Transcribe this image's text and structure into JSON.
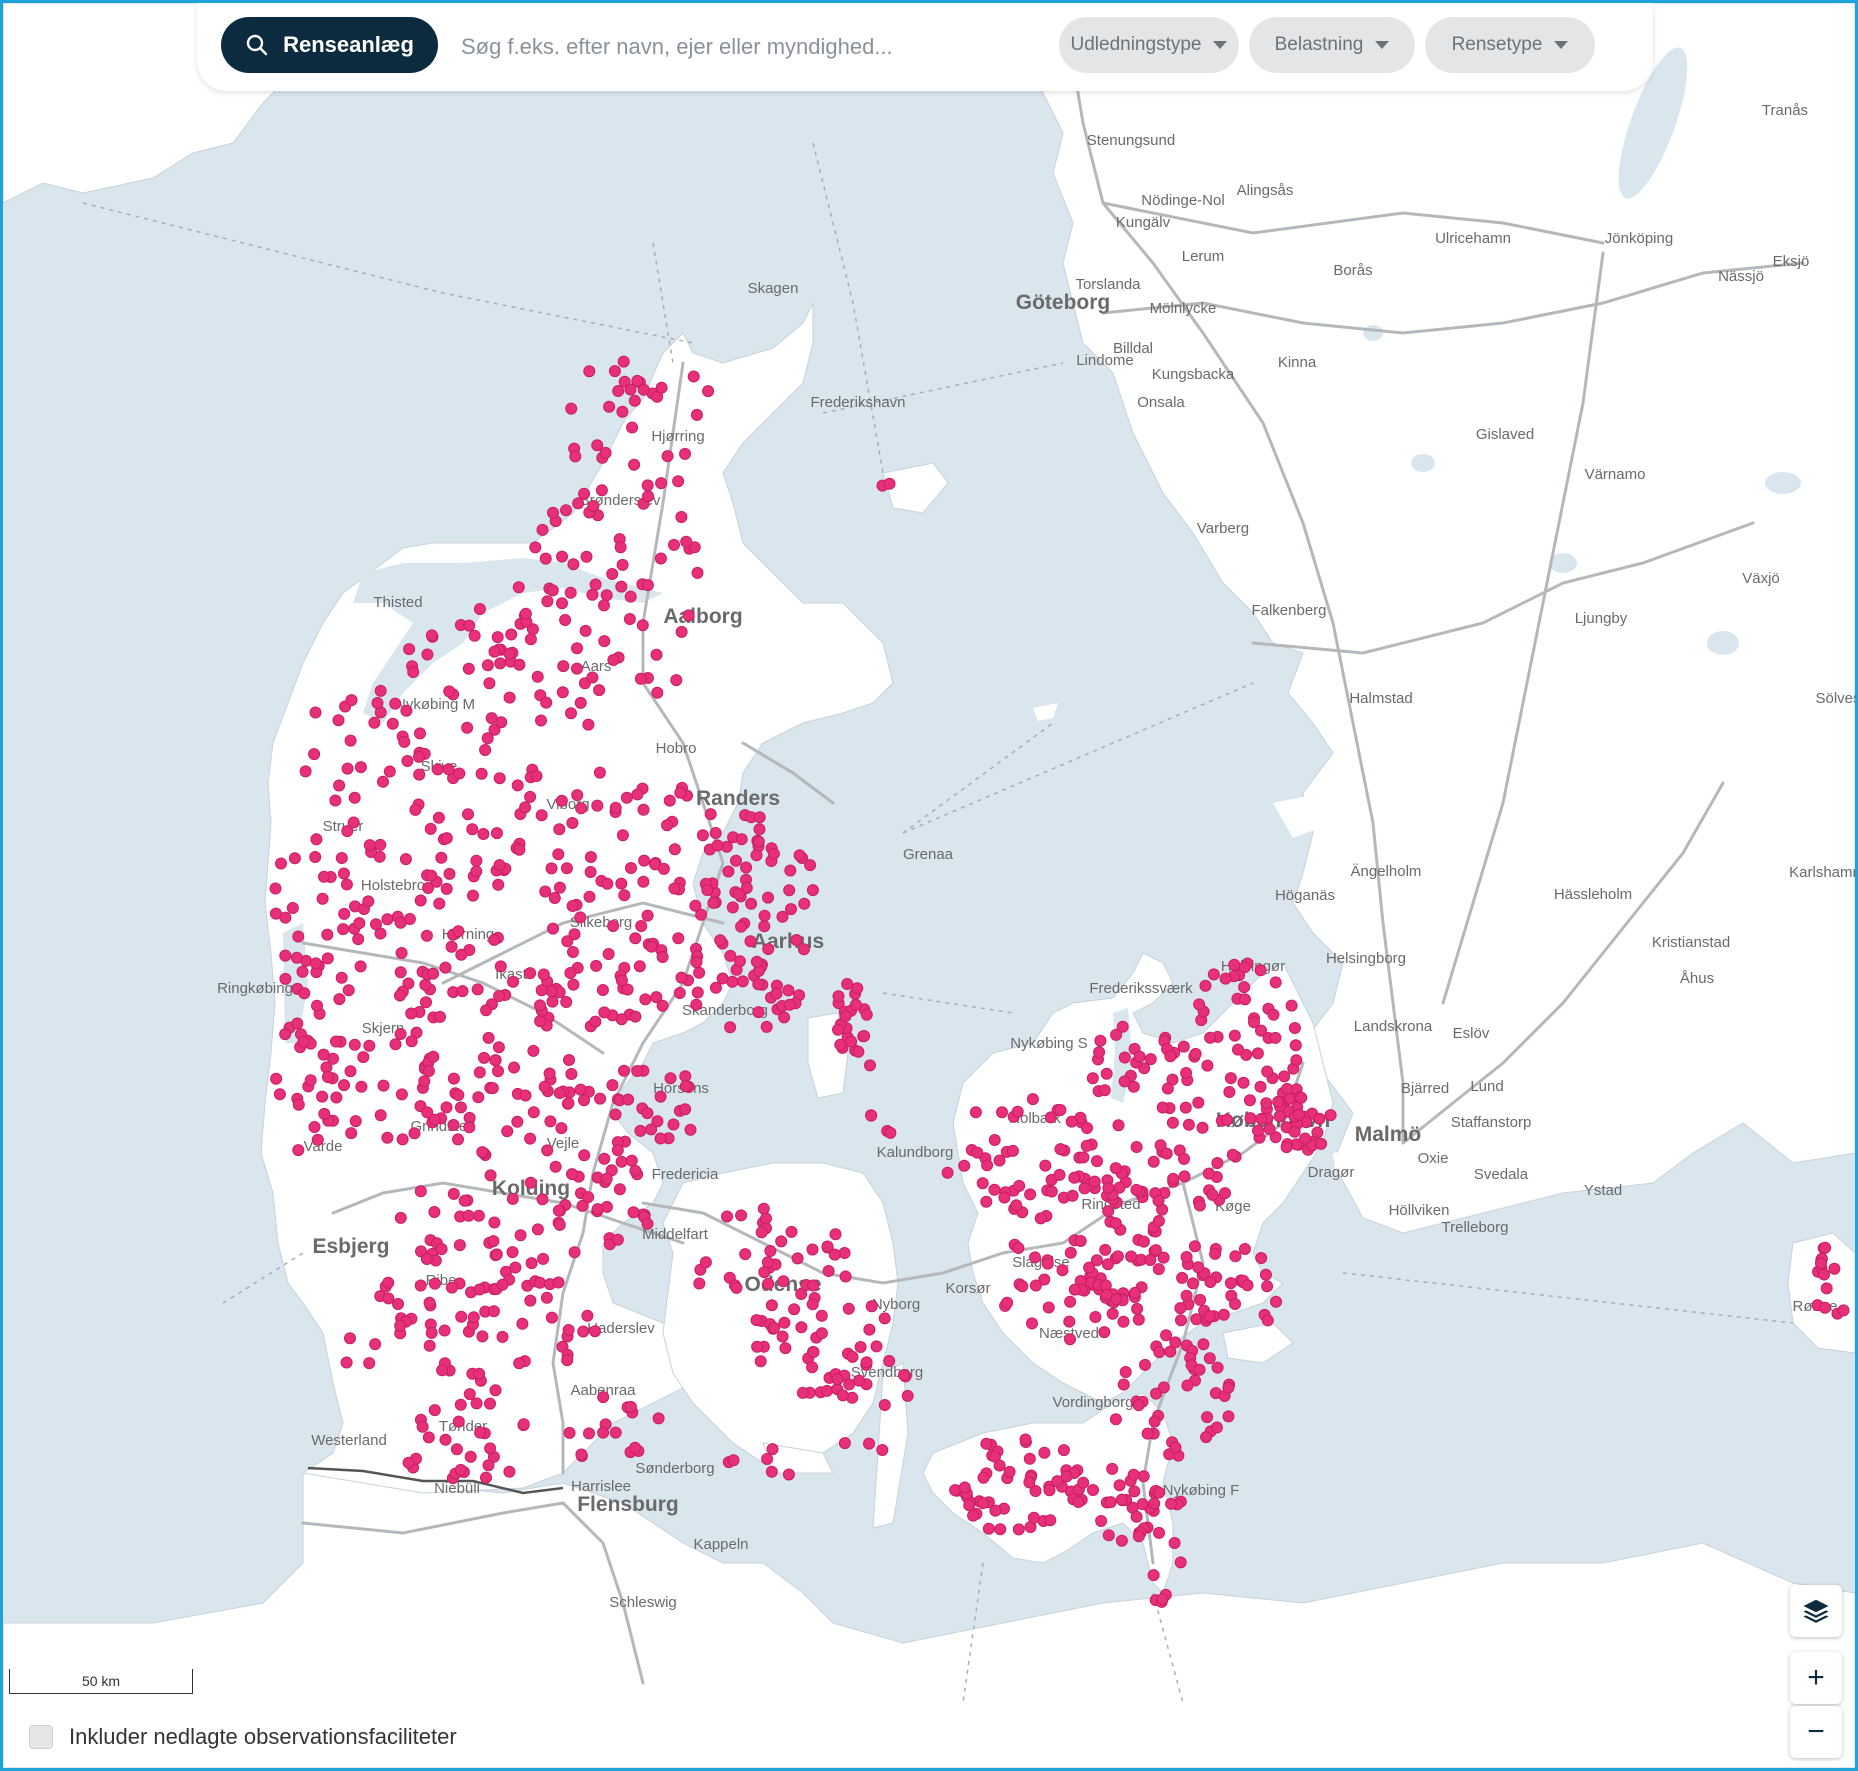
{
  "search": {
    "button_label": "Renseanlæg",
    "placeholder": "Søg f.eks. efter navn, ejer eller myndighed..."
  },
  "filters": [
    {
      "label": "Udledningstype"
    },
    {
      "label": "Belastning"
    },
    {
      "label": "Rensetype"
    }
  ],
  "map_controls": {
    "layers_icon": "layers-icon",
    "zoom_in": "+",
    "zoom_out": "−"
  },
  "scale_label": "50 km",
  "checkbox_label": "Inkluder nedlagte observationsfaciliteter",
  "colors": {
    "marker": "#e8307a",
    "sea": "#d9e6ee",
    "land": "#ffffff",
    "accent": "#0d2b3e",
    "frame": "#1ea3d8"
  },
  "place_labels": {
    "major": [
      "Aalborg",
      "Randers",
      "Aarhus",
      "Kolding",
      "Esbjerg",
      "Odense",
      "København",
      "Malmö",
      "Göteborg",
      "Flensburg"
    ],
    "minor": [
      "Skagen",
      "Frederikshavn",
      "Hjørring",
      "Brønderslev",
      "Thisted",
      "Aars",
      "Nykøbing M",
      "Skive",
      "Hobro",
      "Viborg",
      "Struer",
      "Holstebro",
      "Herning",
      "Ikast",
      "Silkeborg",
      "Grenaa",
      "Ringkøbing",
      "Skjern",
      "Skanderborg",
      "Horsens",
      "Grindsted",
      "Vejle",
      "Fredericia",
      "Varde",
      "Middelfart",
      "Ribe",
      "Haderslev",
      "Aabenraa",
      "Tønder",
      "Sønderborg",
      "Westerland",
      "Niebüll",
      "Harrislee",
      "Kappeln",
      "Schleswig",
      "Nyborg",
      "Svendborg",
      "Kalundborg",
      "Holbæk",
      "Slagelse",
      "Korsør",
      "Ringsted",
      "Køge",
      "Næstved",
      "Vordingborg",
      "Nykøbing F",
      "Frederikssværk",
      "Nykøbing S",
      "Helsingør",
      "Dragør",
      "Stenungsund",
      "Kungälv",
      "Lerum",
      "Borås",
      "Ulricehamn",
      "Jönköping",
      "Eksjö",
      "Nässjö",
      "Tranås",
      "Kungsbacka",
      "Onsala",
      "Kinna",
      "Gislaved",
      "Värnamo",
      "Varberg",
      "Falkenberg",
      "Ljungby",
      "Växjö",
      "Halmstad",
      "Ängelholm",
      "Höganäs",
      "Hässleholm",
      "Helsingborg",
      "Landskrona",
      "Kristianstad",
      "Åhus",
      "Lund",
      "Staffanstorp",
      "Oxie",
      "Svedala",
      "Ystad",
      "Trelleborg",
      "Höllviken",
      "Eslöv",
      "Lindome",
      "Mölnlycke",
      "Torslanda",
      "Rønne",
      "Karlshamn",
      "Nödinge-Nol",
      "Alingsås",
      "Billdal",
      "Bjärred",
      "Sölvesborg"
    ]
  }
}
